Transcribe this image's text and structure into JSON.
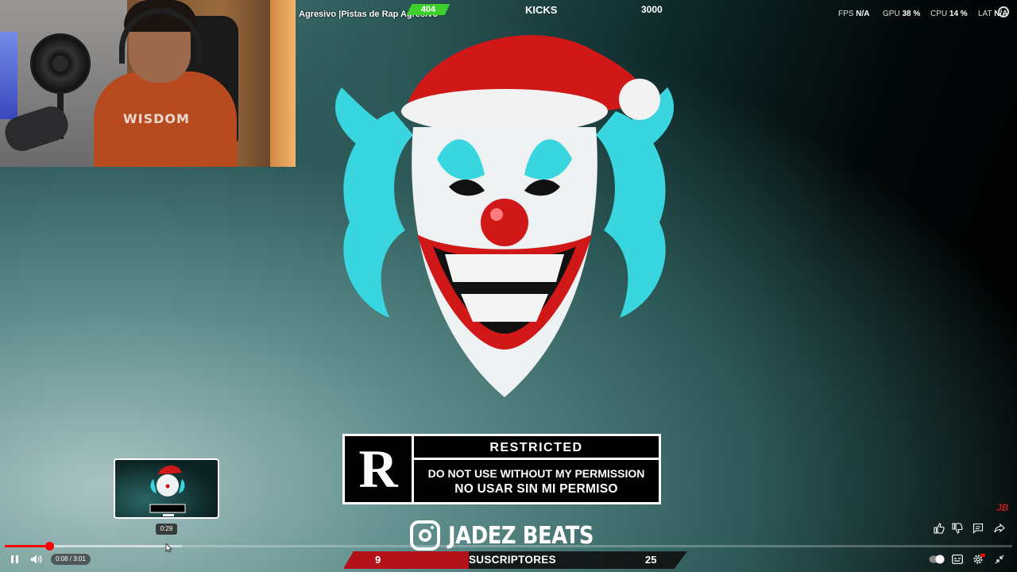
{
  "overlay": {
    "stream_title": "Agresivo |Pistas de Rap Agresivo",
    "viewer_count": "404",
    "kicks_label": "KICKS",
    "kicks_value": "3000"
  },
  "performance": [
    {
      "label": "FPS",
      "value": "N/A"
    },
    {
      "label": "GPU",
      "value": "38 %"
    },
    {
      "label": "CPU",
      "value": "14 %"
    },
    {
      "label": "LAT",
      "value": "N/A"
    }
  ],
  "webcam": {
    "shirt_text": "WISDOM"
  },
  "artwork": {
    "rating_letter": "R",
    "rating_title": "RESTRICTED",
    "warning_en": "DO NOT USE WITHOUT MY PERMISSION",
    "warning_es": "NO USAR SIN MI PERMISO",
    "brand": "JADEZ BEATS",
    "corner_mark": "JB"
  },
  "player": {
    "current_time": "0:08",
    "duration": "3:01",
    "time_display": "0:08 / 3:01",
    "preview_time": "0:29",
    "played_fraction": 0.044,
    "buffered_fraction": 0.176
  },
  "subscribers": {
    "current": "9",
    "label": "SUSCRIPTORES",
    "goal": "25"
  },
  "colors": {
    "accent_red": "#ff0000",
    "viewer_green": "#3fcf2a",
    "subscriber_red": "#b3121a",
    "clown_cyan": "#39d6e0"
  }
}
